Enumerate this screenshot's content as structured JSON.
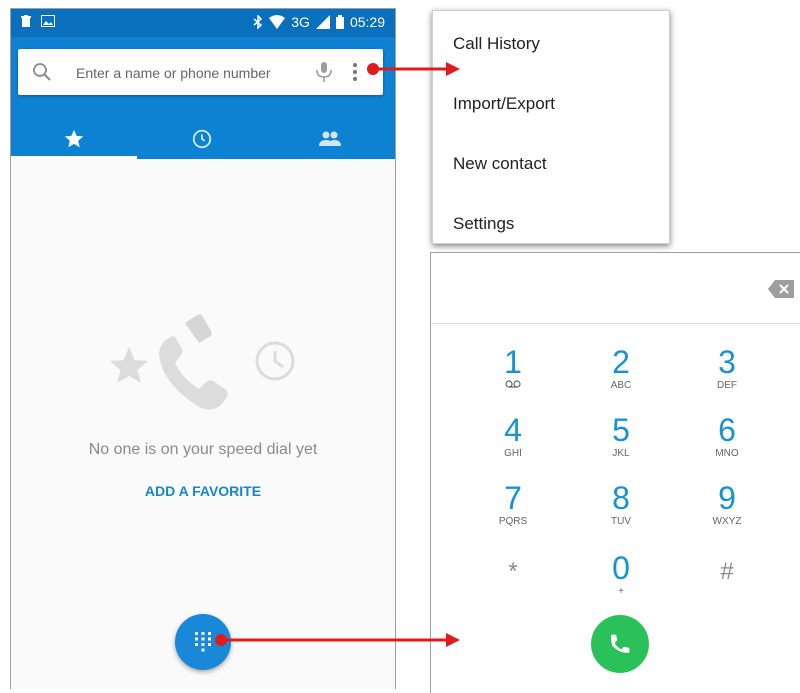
{
  "status_bar": {
    "network": "3G",
    "time": "05:29"
  },
  "search": {
    "placeholder": "Enter a name or phone number"
  },
  "tabs": [
    {
      "icon": "star-icon"
    },
    {
      "icon": "clock-icon"
    },
    {
      "icon": "people-icon"
    }
  ],
  "speed_dial": {
    "empty_text": "No one is on your speed dial yet",
    "add_favorite": "ADD A FAVORITE"
  },
  "menu": {
    "items": [
      "Call History",
      "Import/Export",
      "New contact",
      "Settings"
    ]
  },
  "dialpad": {
    "keys": [
      {
        "digit": "1",
        "letters": ""
      },
      {
        "digit": "2",
        "letters": "ABC"
      },
      {
        "digit": "3",
        "letters": "DEF"
      },
      {
        "digit": "4",
        "letters": "GHI"
      },
      {
        "digit": "5",
        "letters": "JKL"
      },
      {
        "digit": "6",
        "letters": "MNO"
      },
      {
        "digit": "7",
        "letters": "PQRS"
      },
      {
        "digit": "8",
        "letters": "TUV"
      },
      {
        "digit": "9",
        "letters": "WXYZ"
      },
      {
        "digit": "*",
        "letters": ""
      },
      {
        "digit": "0",
        "letters": "+"
      },
      {
        "digit": "#",
        "letters": ""
      }
    ]
  },
  "colors": {
    "primary": "#0d82d2",
    "status_bar": "#0a70bd",
    "accent_blue": "#1a90d6",
    "call_green": "#2bc15a",
    "arrow_red": "#e01b1b"
  }
}
